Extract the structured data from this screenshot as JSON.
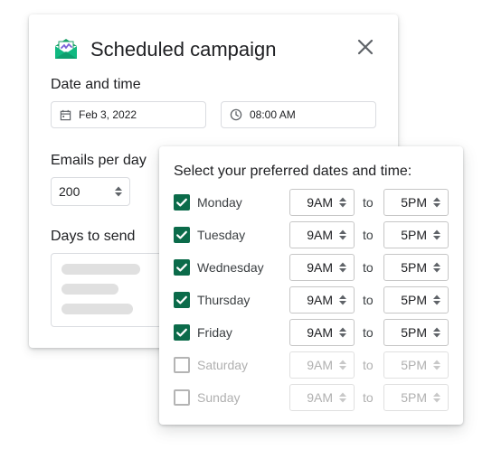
{
  "dialog": {
    "title": "Scheduled campaign",
    "date_label": "Date and time",
    "date_value": "Feb 3, 2022",
    "time_value": "08:00 AM",
    "emails_label": "Emails per day",
    "emails_value": "200",
    "days_label": "Days to send",
    "icons": {
      "logo": "envelope-logo-icon",
      "close": "close-icon",
      "calendar": "calendar-icon",
      "clock": "clock-icon",
      "stepper": "stepper-arrows-icon"
    }
  },
  "popup": {
    "title": "Select your preferred dates and time:",
    "to_text": "to",
    "days": [
      {
        "name": "Monday",
        "checked": true,
        "start": "9AM",
        "end": "5PM"
      },
      {
        "name": "Tuesday",
        "checked": true,
        "start": "9AM",
        "end": "5PM"
      },
      {
        "name": "Wednesday",
        "checked": true,
        "start": "9AM",
        "end": "5PM"
      },
      {
        "name": "Thursday",
        "checked": true,
        "start": "9AM",
        "end": "5PM"
      },
      {
        "name": "Friday",
        "checked": true,
        "start": "9AM",
        "end": "5PM"
      },
      {
        "name": "Saturday",
        "checked": false,
        "start": "9AM",
        "end": "5PM"
      },
      {
        "name": "Sunday",
        "checked": false,
        "start": "9AM",
        "end": "5PM"
      }
    ]
  },
  "colors": {
    "accent": "#0b6b4a",
    "disabled": "#b0b0b0",
    "border": "#dadce0"
  }
}
